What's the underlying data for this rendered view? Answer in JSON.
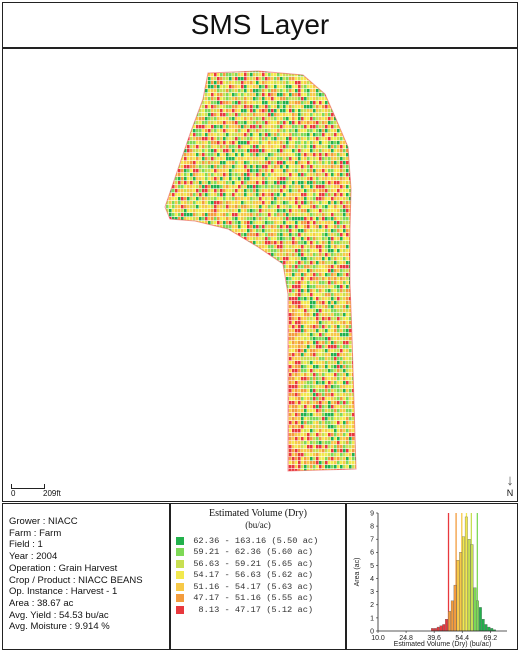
{
  "title": "SMS Layer",
  "map": {
    "scale": {
      "zero": "0",
      "distance": "209ft"
    },
    "north": {
      "arrow": "↓",
      "label": "N"
    },
    "colors": [
      "#22b14c",
      "#7ed957",
      "#c8df52",
      "#f2e94e",
      "#f7c948",
      "#f39c3d",
      "#e8383d"
    ]
  },
  "info": {
    "grower": "Grower : NIACC",
    "farm": "Farm : Farm",
    "field": "Field : 1",
    "year": "Year : 2004",
    "operation": "Operation : Grain Harvest",
    "crop": "Crop / Product : NIACC  BEANS",
    "instance": "Op. Instance : Harvest - 1",
    "area": "Area : 38.67 ac",
    "yield": "Avg. Yield : 54.53 bu/ac",
    "moisture": "Avg. Moisture : 9.914 %"
  },
  "legend": {
    "title": "Estimated Volume (Dry)",
    "unit": "(bu/ac)",
    "items": [
      {
        "label": " 62.36 - 163.16 (5.50 ac)",
        "color": "#22b14c"
      },
      {
        "label": " 59.21 - 62.36 (5.60 ac)",
        "color": "#7ed957"
      },
      {
        "label": " 56.63 - 59.21 (5.65 ac)",
        "color": "#c8df52"
      },
      {
        "label": " 54.17 - 56.63 (5.62 ac)",
        "color": "#f2e94e"
      },
      {
        "label": " 51.16 - 54.17 (5.63 ac)",
        "color": "#f7c948"
      },
      {
        "label": " 47.17 - 51.16 (5.55 ac)",
        "color": "#f39c3d"
      },
      {
        "label": "  8.13 - 47.17 (5.12 ac)",
        "color": "#e8383d"
      }
    ]
  },
  "histogram": {
    "xlabel": "Estimated Volume (Dry) (bu/ac)",
    "ylabel": "Area (ac)",
    "x_ticks": [
      "10.0",
      "24.8",
      "39.6",
      "54.4",
      "69.2"
    ],
    "y_ticks": [
      "0",
      "1",
      "2",
      "3",
      "4",
      "5",
      "6",
      "7",
      "8",
      "9"
    ],
    "x_range": [
      10.0,
      78.0
    ],
    "y_range": [
      0,
      9
    ],
    "bin_width": 1.48,
    "bins": [
      {
        "x": 38.1,
        "v": 0.2,
        "c": 6
      },
      {
        "x": 39.6,
        "v": 0.2,
        "c": 6
      },
      {
        "x": 41.1,
        "v": 0.3,
        "c": 6
      },
      {
        "x": 42.6,
        "v": 0.4,
        "c": 6
      },
      {
        "x": 44.0,
        "v": 0.5,
        "c": 6
      },
      {
        "x": 45.5,
        "v": 0.9,
        "c": 6
      },
      {
        "x": 47.0,
        "v": 1.5,
        "c": 5
      },
      {
        "x": 48.5,
        "v": 2.3,
        "c": 5
      },
      {
        "x": 50.0,
        "v": 3.5,
        "c": 5
      },
      {
        "x": 51.5,
        "v": 5.4,
        "c": 4
      },
      {
        "x": 52.9,
        "v": 6.0,
        "c": 4
      },
      {
        "x": 54.4,
        "v": 7.2,
        "c": 3
      },
      {
        "x": 55.9,
        "v": 8.7,
        "c": 3
      },
      {
        "x": 57.4,
        "v": 7.0,
        "c": 2
      },
      {
        "x": 58.9,
        "v": 6.6,
        "c": 2
      },
      {
        "x": 60.4,
        "v": 3.3,
        "c": 1
      },
      {
        "x": 61.8,
        "v": 2.3,
        "c": 1
      },
      {
        "x": 63.3,
        "v": 1.8,
        "c": 0
      },
      {
        "x": 64.8,
        "v": 0.9,
        "c": 0
      },
      {
        "x": 66.3,
        "v": 0.5,
        "c": 0
      },
      {
        "x": 67.8,
        "v": 0.3,
        "c": 0
      },
      {
        "x": 69.3,
        "v": 0.2,
        "c": 0
      },
      {
        "x": 70.7,
        "v": 0.1,
        "c": 0
      }
    ],
    "break_lines": [
      {
        "x": 47.17,
        "c": 6
      },
      {
        "x": 51.16,
        "c": 5
      },
      {
        "x": 54.17,
        "c": 4
      },
      {
        "x": 56.63,
        "c": 3
      },
      {
        "x": 59.21,
        "c": 2
      },
      {
        "x": 62.36,
        "c": 1
      }
    ]
  }
}
